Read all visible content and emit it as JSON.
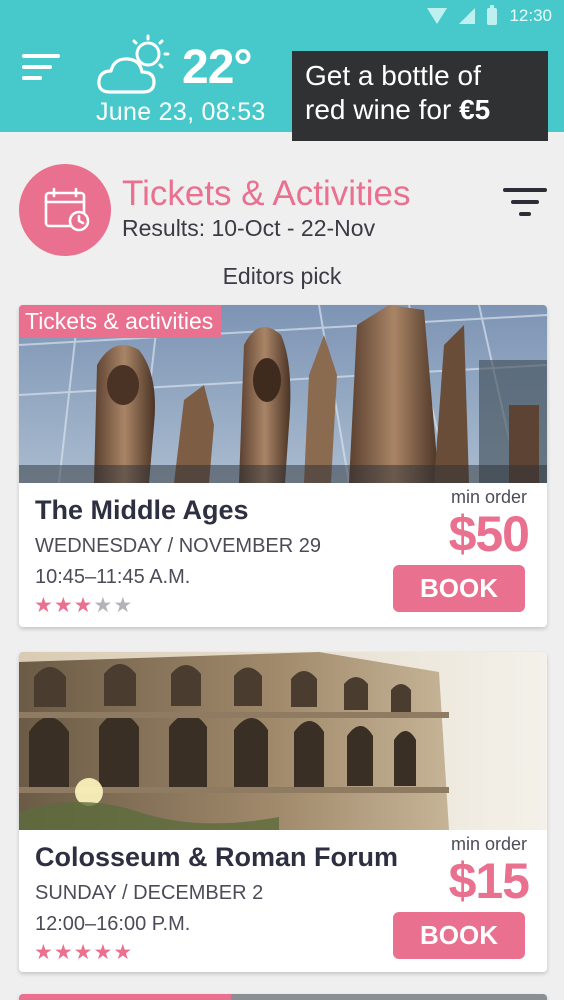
{
  "status_bar": {
    "time": "12:30"
  },
  "header": {
    "temperature": "22°",
    "date": "June 23, 08:53",
    "weather_icon": "partly-sunny-icon",
    "menu_icon": "hamburger-menu-icon",
    "promo": {
      "line1": "Get a bottle of",
      "line2_prefix": "red wine for ",
      "price": "€5"
    }
  },
  "section": {
    "icon": "calendar-clock-icon",
    "title": "Tickets & Activities",
    "subtitle": "Results: 10-Oct - 22-Nov",
    "filter_icon": "filter-icon",
    "editors_pick": "Editors pick"
  },
  "cards": [
    {
      "tag": "Tickets & activities",
      "title": "The Middle Ages",
      "date": "WEDNESDAY / NOVEMBER 29",
      "time": "10:45–11:45 A.M.",
      "rating": 3,
      "rating_max": 5,
      "min_order_label": "min order",
      "price": "$50",
      "book_label": "BOOK"
    },
    {
      "title": "Colosseum & Roman Forum",
      "date": "SUNDAY / DECEMBER 2",
      "time": "12:00–16:00 P.M.",
      "rating": 5,
      "rating_max": 5,
      "min_order_label": "min order",
      "price": "$15",
      "book_label": "BOOK"
    }
  ],
  "colors": {
    "teal": "#47c9cc",
    "pink": "#e9708e",
    "dark": "#2f3133"
  }
}
